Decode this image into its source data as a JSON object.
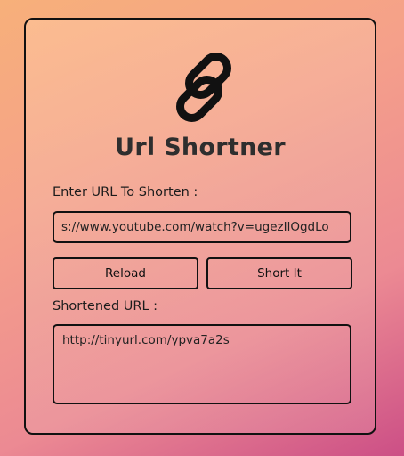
{
  "app": {
    "title": "Url Shortner",
    "logo_icon": "link-icon"
  },
  "form": {
    "input_label": "Enter URL To Shorten :",
    "input_value": "s://www.youtube.com/watch?v=ugezIlOgdLo",
    "reload_label": "Reload",
    "short_label": "Short It",
    "output_label": "Shortened URL :",
    "output_value": "http://tinyurl.com/ypva7a2s"
  },
  "colors": {
    "border": "#111111",
    "title": "#2e2e2e"
  }
}
